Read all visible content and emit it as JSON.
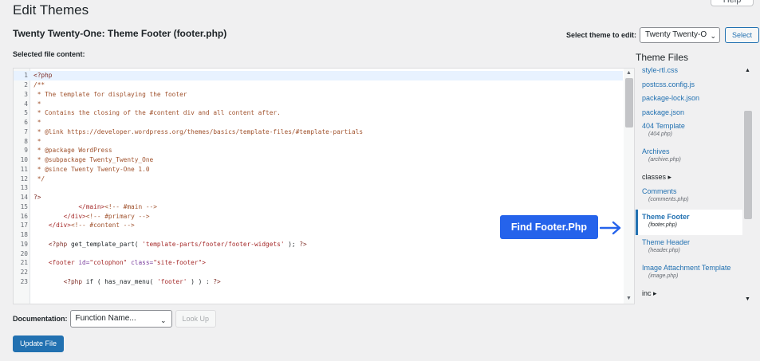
{
  "help_tab": "Help",
  "page_title": "Edit Themes",
  "file_heading": "Twenty Twenty-One: Theme Footer (footer.php)",
  "selected_file_label": "Selected file content:",
  "theme_select": {
    "label": "Select theme to edit:",
    "value": "Twenty Twenty-O",
    "button": "Select"
  },
  "code_lines": [
    {
      "n": "1",
      "parts": [
        [
          "c-php",
          "<?php"
        ]
      ]
    },
    {
      "n": "2",
      "parts": [
        [
          "c-com",
          "/**"
        ]
      ]
    },
    {
      "n": "3",
      "parts": [
        [
          "c-com",
          " * The template for displaying the footer"
        ]
      ]
    },
    {
      "n": "4",
      "parts": [
        [
          "c-com",
          " *"
        ]
      ]
    },
    {
      "n": "5",
      "parts": [
        [
          "c-com",
          " * Contains the closing of the #content div and all content after."
        ]
      ]
    },
    {
      "n": "6",
      "parts": [
        [
          "c-com",
          " *"
        ]
      ]
    },
    {
      "n": "7",
      "parts": [
        [
          "c-com",
          " * @link https://developer.wordpress.org/themes/basics/template-files/#template-partials"
        ]
      ]
    },
    {
      "n": "8",
      "parts": [
        [
          "c-com",
          " *"
        ]
      ]
    },
    {
      "n": "9",
      "parts": [
        [
          "c-com",
          " * @package WordPress"
        ]
      ]
    },
    {
      "n": "10",
      "parts": [
        [
          "c-com",
          " * @subpackage Twenty_Twenty_One"
        ]
      ]
    },
    {
      "n": "11",
      "parts": [
        [
          "c-com",
          " * @since Twenty Twenty-One 1.0"
        ]
      ]
    },
    {
      "n": "12",
      "parts": [
        [
          "c-com",
          " */"
        ]
      ]
    },
    {
      "n": "13",
      "parts": []
    },
    {
      "n": "14",
      "parts": [
        [
          "c-php",
          "?>"
        ]
      ]
    },
    {
      "n": "15",
      "parts": [
        [
          "c-def",
          "            "
        ],
        [
          "c-tag",
          "</main>"
        ],
        [
          "c-com",
          "<!-- #main -->"
        ]
      ]
    },
    {
      "n": "16",
      "parts": [
        [
          "c-def",
          "        "
        ],
        [
          "c-tag",
          "</div>"
        ],
        [
          "c-com",
          "<!-- #primary -->"
        ]
      ]
    },
    {
      "n": "17",
      "parts": [
        [
          "c-def",
          "    "
        ],
        [
          "c-tag",
          "</div>"
        ],
        [
          "c-com",
          "<!-- #content -->"
        ]
      ]
    },
    {
      "n": "18",
      "parts": []
    },
    {
      "n": "19",
      "parts": [
        [
          "c-def",
          "    "
        ],
        [
          "c-php",
          "<?php"
        ],
        [
          "c-fn",
          " get_template_part( "
        ],
        [
          "c-str",
          "'template-parts/footer/footer-widgets'"
        ],
        [
          "c-fn",
          " ); "
        ],
        [
          "c-php",
          "?>"
        ]
      ]
    },
    {
      "n": "20",
      "parts": []
    },
    {
      "n": "21",
      "parts": [
        [
          "c-def",
          "    "
        ],
        [
          "c-tag",
          "<footer"
        ],
        [
          "c-attr",
          " id="
        ],
        [
          "c-str",
          "\"colophon\""
        ],
        [
          "c-attr",
          " class="
        ],
        [
          "c-str",
          "\"site-footer\""
        ],
        [
          "c-tag",
          ">"
        ]
      ]
    },
    {
      "n": "22",
      "parts": []
    },
    {
      "n": "23",
      "parts": [
        [
          "c-def",
          "        "
        ],
        [
          "c-php",
          "<?php"
        ],
        [
          "c-fn",
          " if ( has_nav_menu( "
        ],
        [
          "c-str",
          "'footer'"
        ],
        [
          "c-fn",
          " ) ) : "
        ],
        [
          "c-php",
          "?>"
        ]
      ]
    }
  ],
  "files_title": "Theme Files",
  "files": [
    {
      "name": "style-rtl.css",
      "sub": "",
      "type": "file"
    },
    {
      "name": "postcss.config.js",
      "sub": "",
      "type": "file"
    },
    {
      "name": "package-lock.json",
      "sub": "",
      "type": "file"
    },
    {
      "name": "package.json",
      "sub": "",
      "type": "file"
    },
    {
      "name": "404 Template",
      "sub": "(404.php)",
      "type": "file"
    },
    {
      "name": "Archives",
      "sub": "(archive.php)",
      "type": "file"
    },
    {
      "name": "classes ▸",
      "sub": "",
      "type": "folder"
    },
    {
      "name": "Comments",
      "sub": "(comments.php)",
      "type": "file"
    },
    {
      "name": "Theme Footer",
      "sub": "(footer.php)",
      "type": "current"
    },
    {
      "name": "Theme Header",
      "sub": "(header.php)",
      "type": "file"
    },
    {
      "name": "Image Attachment Template",
      "sub": "(image.php)",
      "type": "file"
    },
    {
      "name": "inc ▸",
      "sub": "",
      "type": "folder"
    }
  ],
  "callout": "Find Footer.Php",
  "documentation": {
    "label": "Documentation:",
    "placeholder": "Function Name...",
    "lookup": "Look Up"
  },
  "update_button": "Update File",
  "colors": {
    "accent": "#2271b1",
    "callout": "#2563eb"
  }
}
